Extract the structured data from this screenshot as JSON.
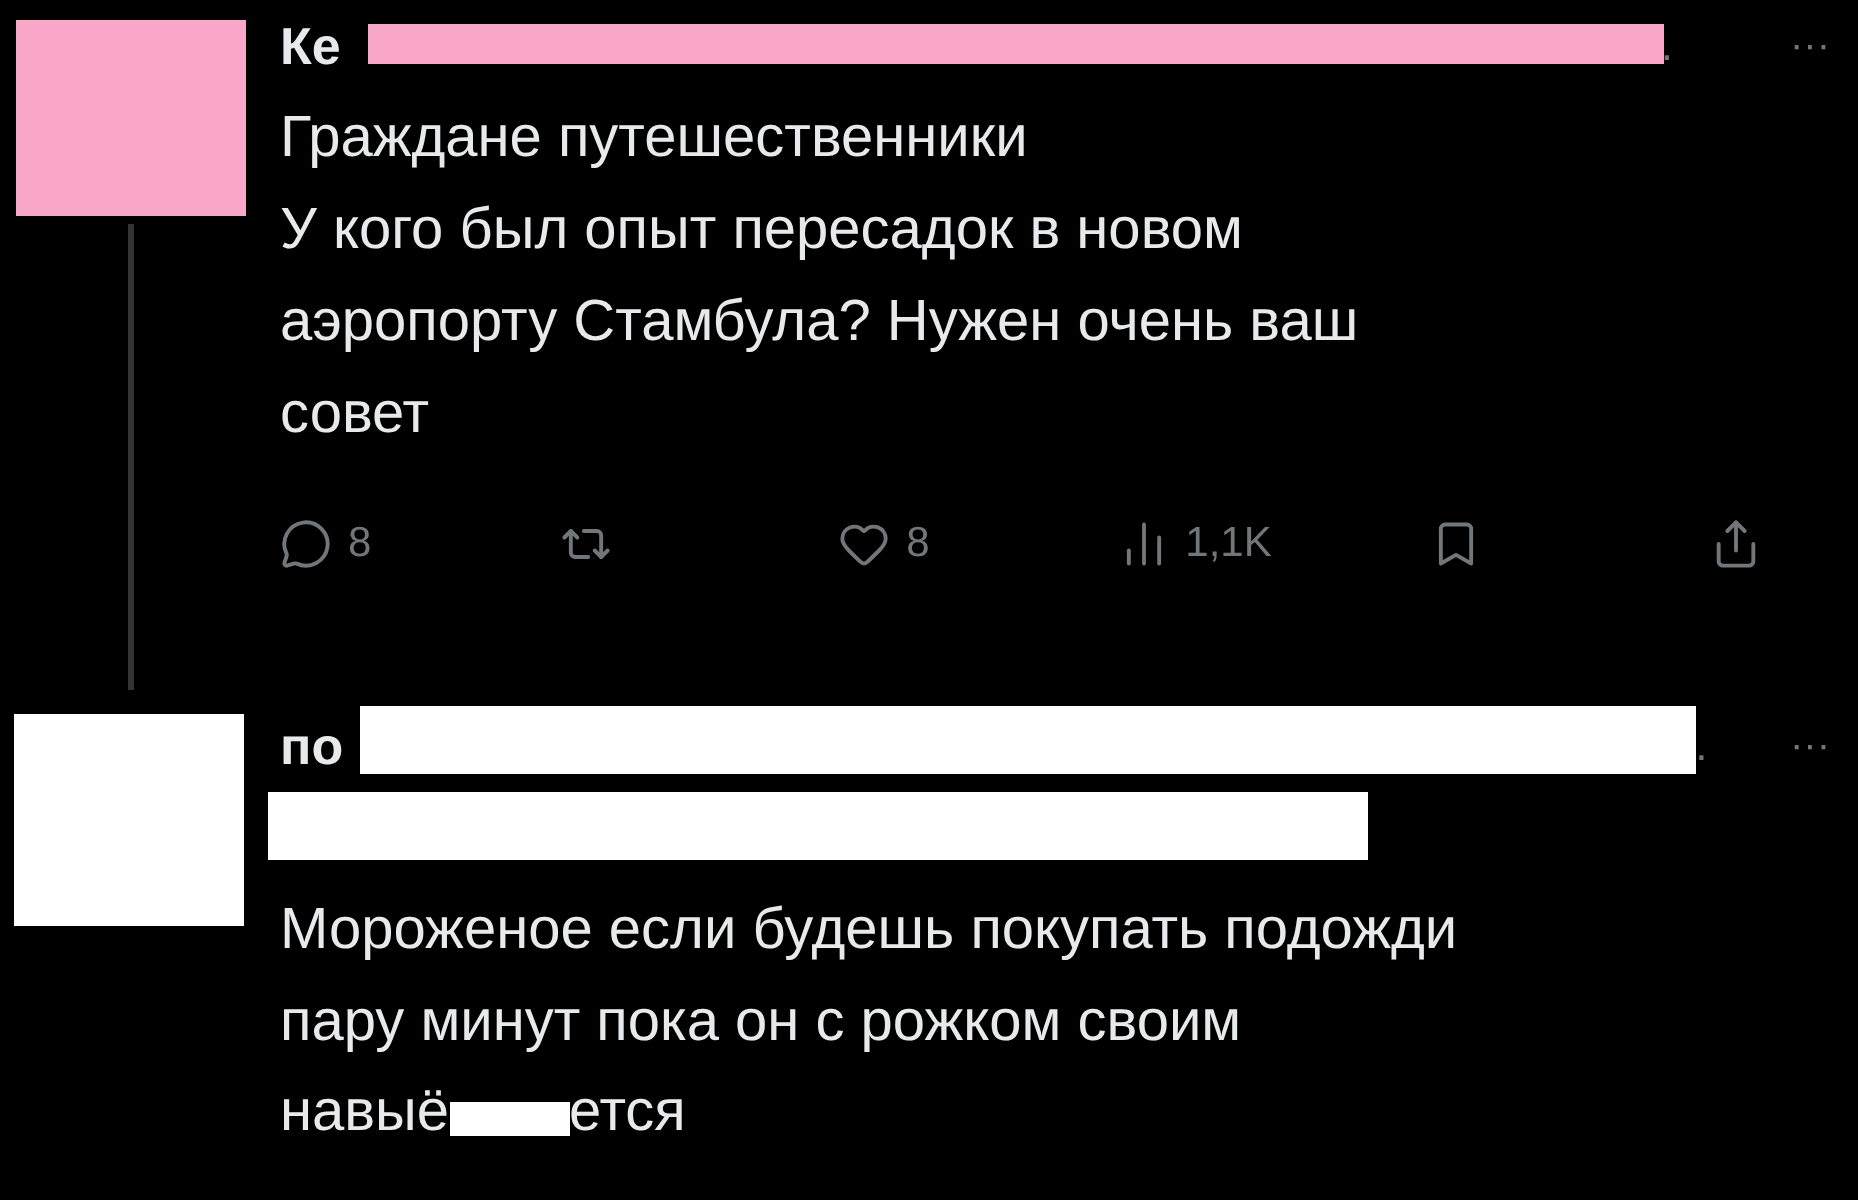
{
  "post": {
    "author_visible": "Ке",
    "author_tail": ".",
    "menu": "···",
    "lines": [
      "Граждане путешественники",
      "У кого был опыт пересадок в новом",
      "аэропорту Стамбула? Нужен очень ваш",
      "совет"
    ],
    "actions": [
      {
        "kind": "reply",
        "count": "8"
      },
      {
        "kind": "repost"
      },
      {
        "kind": "like",
        "count": "8"
      },
      {
        "kind": "views",
        "count": "1,1K"
      },
      {
        "kind": "bookmark"
      },
      {
        "kind": "share"
      }
    ]
  },
  "reply": {
    "author_visible": "по",
    "author_tail": ".",
    "menu": "···",
    "lines": [
      {
        "kind": "plain",
        "text": "Мороженое если будешь покупать подожди"
      },
      {
        "kind": "plain",
        "text": "пару минут пока он с рожком своим"
      },
      {
        "kind": "redacted",
        "before": "навыё",
        "after": "ется"
      }
    ]
  }
}
